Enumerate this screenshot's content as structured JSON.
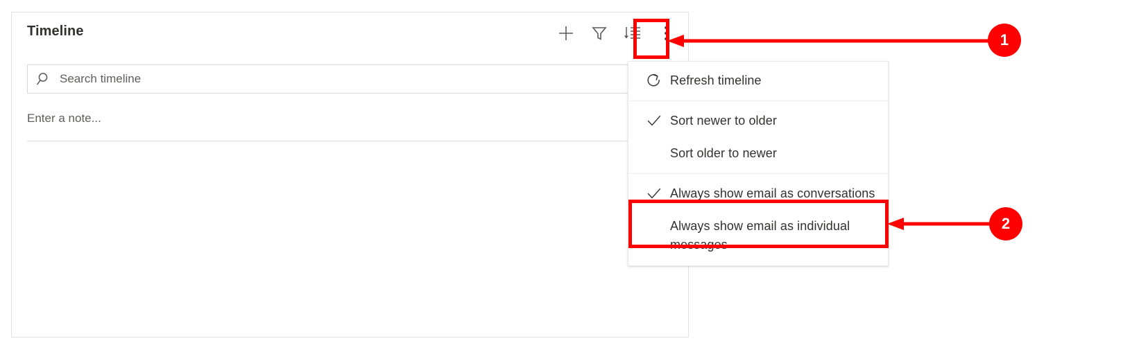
{
  "panel": {
    "title": "Timeline",
    "toolbar": [
      {
        "name": "add-icon",
        "label": "Add"
      },
      {
        "name": "filter-icon",
        "label": "Filter"
      },
      {
        "name": "sort-icon",
        "label": "Sort"
      },
      {
        "name": "more-commands-icon",
        "label": "More commands"
      }
    ],
    "search": {
      "placeholder": "Search timeline",
      "value": "",
      "icon": "search-icon"
    },
    "note": {
      "placeholder": "Enter a note..."
    }
  },
  "menu": {
    "items": [
      {
        "label": "Refresh timeline",
        "icon": "refresh-icon",
        "checked": false
      },
      {
        "label": "Sort newer to older",
        "icon": "checkmark-icon",
        "checked": true
      },
      {
        "label": "Sort older to newer",
        "icon": "",
        "checked": false
      },
      {
        "label": "Always show email as conversations",
        "icon": "checkmark-icon",
        "checked": true
      },
      {
        "label": "Always show email as individual messages",
        "icon": "",
        "checked": false
      }
    ]
  },
  "annotations": {
    "accent_color": "#FF0000",
    "badges": [
      {
        "number": "1",
        "target": "more-commands-icon"
      },
      {
        "number": "2",
        "target": "always-show-email-as-conversations"
      }
    ]
  }
}
